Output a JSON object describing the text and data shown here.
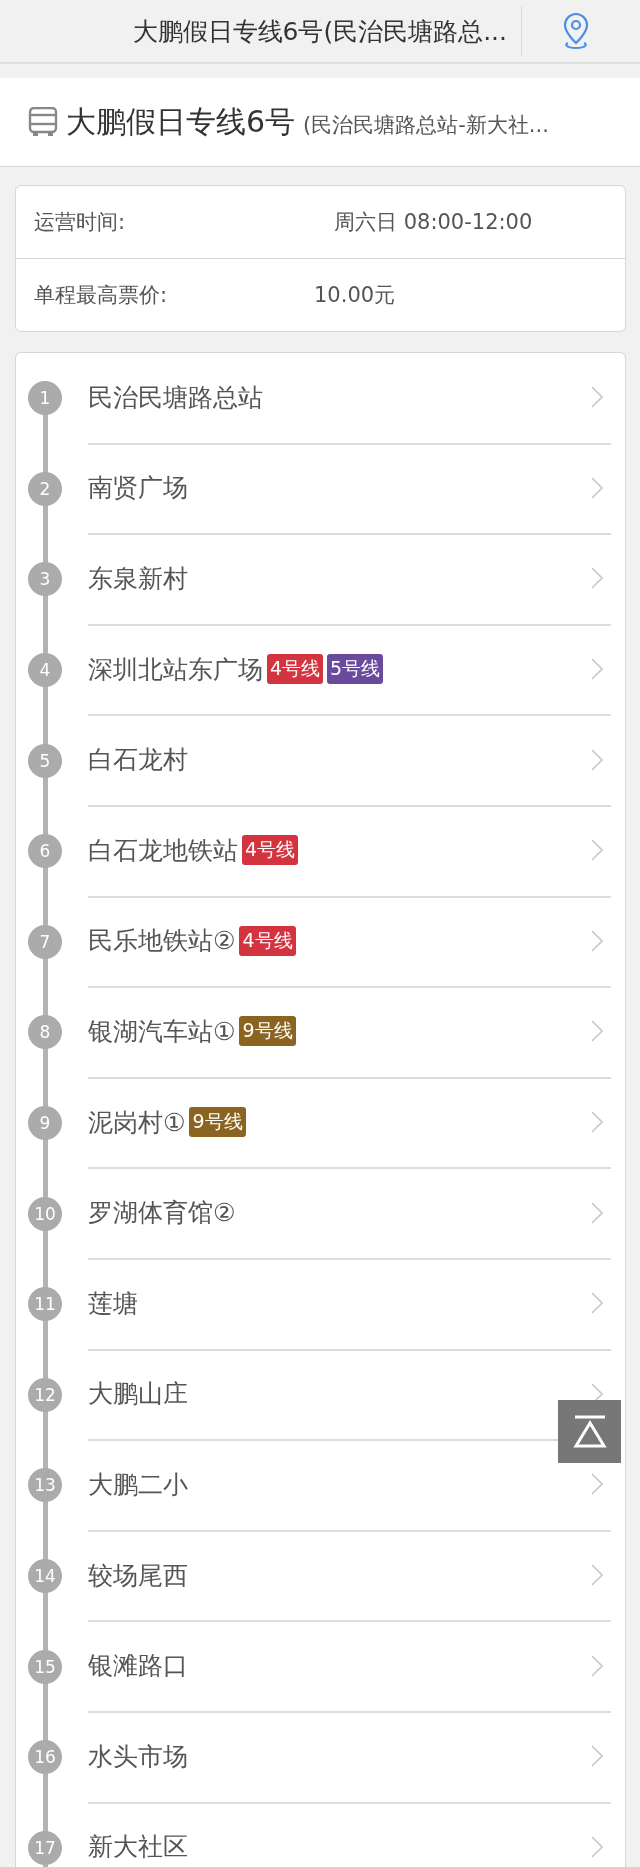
{
  "header": {
    "title": "大鹏假日专线6号(民治民塘路总..."
  },
  "route": {
    "name": "大鹏假日专线6号",
    "terminals": "(民治民塘路总站-新大社..."
  },
  "info": [
    {
      "label": "运营时间:",
      "value": "周六日 08:00-12:00"
    },
    {
      "label": "单程最高票价:",
      "value": "10.00元"
    }
  ],
  "stops": [
    {
      "number": "1",
      "name": "民治民塘路总站"
    },
    {
      "number": "2",
      "name": "南贤广场"
    },
    {
      "number": "3",
      "name": "东泉新村"
    },
    {
      "number": "4",
      "name": "深圳北站东广场",
      "lines": [
        {
          "label": "4号线",
          "color": "#d3343f"
        },
        {
          "label": "5号线",
          "color": "#6a4a9c"
        }
      ]
    },
    {
      "number": "5",
      "name": "白石龙村"
    },
    {
      "number": "6",
      "name": "白石龙地铁站",
      "lines": [
        {
          "label": "4号线",
          "color": "#d3343f"
        }
      ]
    },
    {
      "number": "7",
      "name": "民乐地铁站②",
      "lines": [
        {
          "label": "4号线",
          "color": "#d3343f"
        }
      ]
    },
    {
      "number": "8",
      "name": "银湖汽车站①",
      "lines": [
        {
          "label": "9号线",
          "color": "#8a6420"
        }
      ]
    },
    {
      "number": "9",
      "name": "泥岗村①",
      "lines": [
        {
          "label": "9号线",
          "color": "#8a6420"
        }
      ]
    },
    {
      "number": "10",
      "name": "罗湖体育馆②"
    },
    {
      "number": "11",
      "name": "莲塘"
    },
    {
      "number": "12",
      "name": "大鹏山庄"
    },
    {
      "number": "13",
      "name": "大鹏二小"
    },
    {
      "number": "14",
      "name": "较场尾西"
    },
    {
      "number": "15",
      "name": "银滩路口"
    },
    {
      "number": "16",
      "name": "水头市场"
    },
    {
      "number": "17",
      "name": "新大社区"
    }
  ]
}
